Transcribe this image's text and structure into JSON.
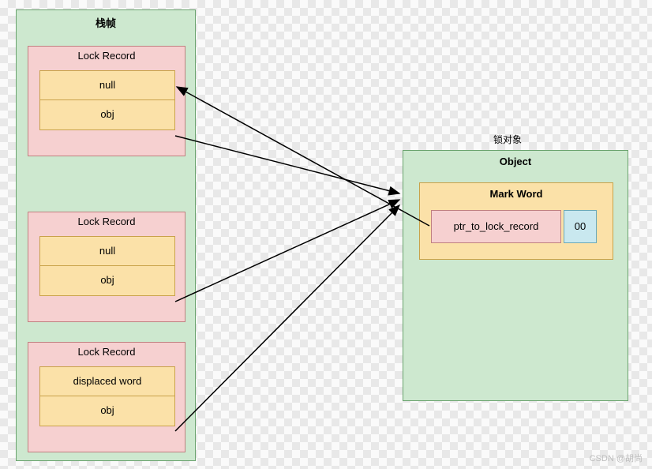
{
  "stack_frame": {
    "title": "栈帧",
    "records": [
      {
        "label": "Lock Record",
        "cell_a": "null",
        "cell_b": "obj"
      },
      {
        "label": "Lock Record",
        "cell_a": "null",
        "cell_b": "obj"
      },
      {
        "label": "Lock Record",
        "cell_a": "displaced word",
        "cell_b": "obj"
      }
    ]
  },
  "lock_object": {
    "caption": "锁对象",
    "title": "Object",
    "mark_word": {
      "title": "Mark Word",
      "ptr_label": "ptr_to_lock_record",
      "flag": "00"
    }
  },
  "watermark": "CSDN @胡尚",
  "colors": {
    "green": "#cde8cf",
    "pink": "#f6d0d0",
    "orange": "#fbe1a8",
    "cyan": "#c9e8ef"
  }
}
